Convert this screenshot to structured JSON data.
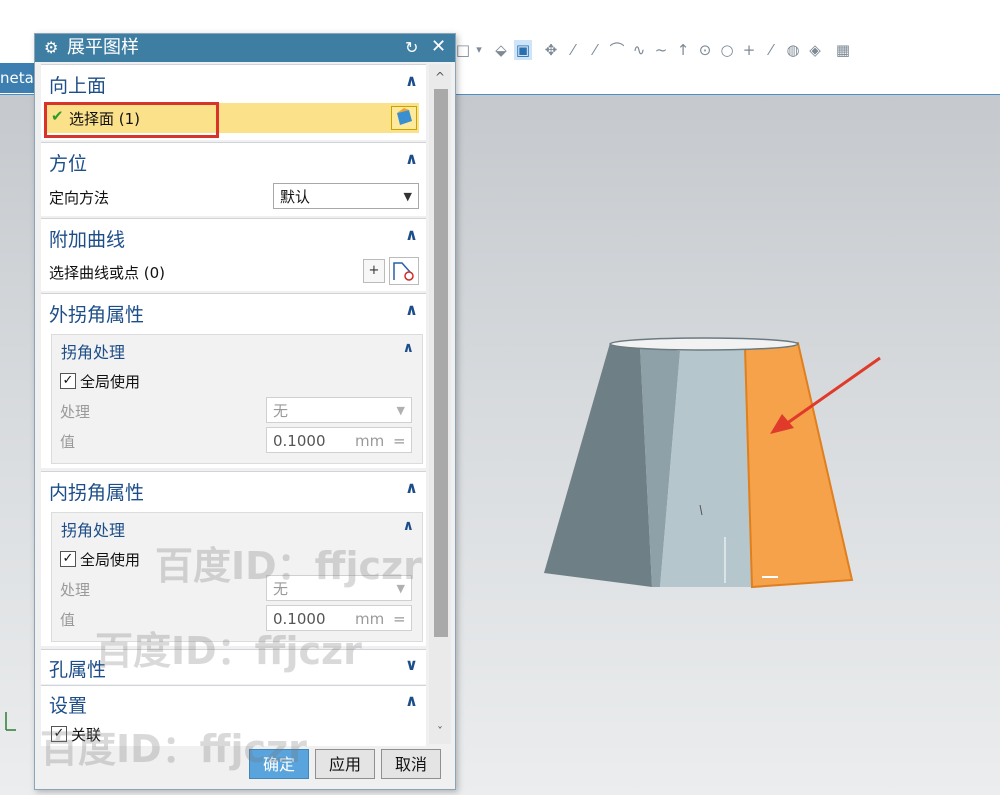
{
  "toolbar": {
    "icons": [
      "box-select-icon",
      "dropdown-arrow-icon",
      "shaded-body-icon",
      "cube-icon",
      "move-icon",
      "line-icon",
      "line2-icon",
      "curve-icon",
      "spline-icon",
      "wave-icon",
      "arrow-up-icon",
      "circle-dot-icon",
      "circle-icon",
      "plus-icon",
      "line3-icon",
      "face-icon",
      "sheet-icon",
      "grid-icon"
    ]
  },
  "left_tab": {
    "label": "neta"
  },
  "dialog": {
    "title": "展平图样",
    "sections": {
      "upward_face": {
        "title": "向上面",
        "select_face_label": "选择面 (1)"
      },
      "orientation": {
        "title": "方位",
        "method_label": "定向方法",
        "method_value": "默认"
      },
      "additional_curves": {
        "title": "附加曲线",
        "select_label": "选择曲线或点 (0)"
      },
      "outer_corner": {
        "title": "外拐角属性",
        "sub_title": "拐角处理",
        "global_use_label": "全局使用",
        "treatment_label": "处理",
        "treatment_value": "无",
        "value_label": "值",
        "value_value": "0.1000",
        "value_unit": "mm",
        "value_eq": "="
      },
      "inner_corner": {
        "title": "内拐角属性",
        "sub_title": "拐角处理",
        "global_use_label": "全局使用",
        "treatment_label": "处理",
        "treatment_value": "无",
        "value_label": "值",
        "value_value": "0.1000",
        "value_unit": "mm",
        "value_eq": "="
      },
      "hole": {
        "title": "孔属性"
      },
      "settings": {
        "title": "设置",
        "associative_label": "关联"
      }
    },
    "buttons": {
      "ok": "确定",
      "apply": "应用",
      "cancel": "取消"
    }
  },
  "watermark": "百度ID：ffjczr",
  "colors": {
    "title_bar": "#3f7ea3",
    "section_title": "#1d4e89",
    "highlight_face": "#f5a24a",
    "selection_box": "#d9342b",
    "arrow": "#e03a2a"
  }
}
